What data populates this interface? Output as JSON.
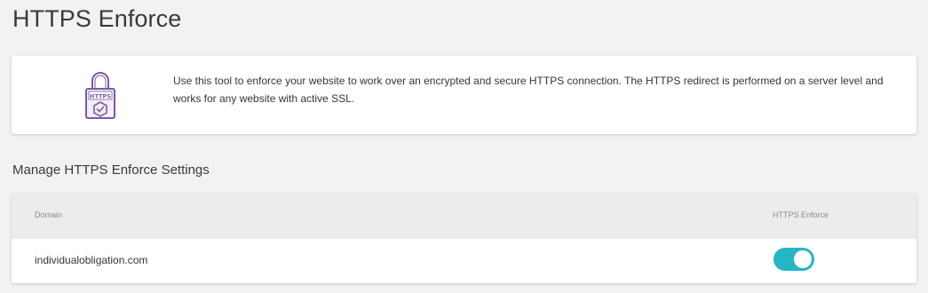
{
  "page": {
    "title": "HTTPS Enforce"
  },
  "info": {
    "icon": "https-lock-icon",
    "icon_label": "HTTPS",
    "description": "Use this tool to enforce your website to work over an encrypted and secure HTTPS connection. The HTTPS redirect is performed on a server level and works for any website with active SSL."
  },
  "settings": {
    "title": "Manage HTTPS Enforce Settings",
    "columns": [
      "Domain",
      "HTTPS Enforce"
    ],
    "rows": [
      {
        "domain": "individualobligation.com",
        "enforce_enabled": true
      }
    ]
  },
  "colors": {
    "accent": "#25b6c4",
    "icon_purple": "#7b5aa6"
  }
}
